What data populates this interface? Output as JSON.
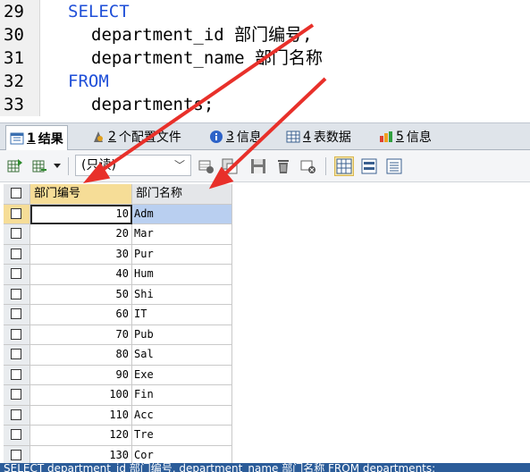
{
  "editor": {
    "lines": [
      {
        "num": "29",
        "text": "SELECT",
        "keyword": true
      },
      {
        "num": "30",
        "text": "department_id 部门编号,",
        "keyword": false
      },
      {
        "num": "31",
        "text": "department_name 部门名称",
        "keyword": false
      },
      {
        "num": "32",
        "text": "FROM",
        "keyword": true
      },
      {
        "num": "33",
        "text": "departments;",
        "keyword": false
      }
    ]
  },
  "tabs": [
    {
      "num": "1",
      "label": "结果",
      "icon": "results-icon",
      "active": true
    },
    {
      "num": "2",
      "label": "个配置文件",
      "icon": "profile-icon",
      "active": false
    },
    {
      "num": "3",
      "label": "信息",
      "icon": "info-icon",
      "active": false
    },
    {
      "num": "4",
      "label": "表数据",
      "icon": "table-data-icon",
      "active": false
    },
    {
      "num": "5",
      "label": "信息",
      "icon": "history-info-icon",
      "active": false
    }
  ],
  "toolbar": {
    "mode_select": "(只读)",
    "buttons": [
      "export-icon",
      "import-icon",
      "add-row-icon",
      "duplicate-row-icon",
      "save-icon",
      "delete-icon",
      "refresh-icon",
      "grid-view-icon",
      "form-view-icon",
      "text-view-icon"
    ]
  },
  "grid": {
    "columns": [
      "部门编号",
      "部门名称"
    ],
    "rows": [
      [
        "10",
        "Adm"
      ],
      [
        "20",
        "Mar"
      ],
      [
        "30",
        "Pur"
      ],
      [
        "40",
        "Hum"
      ],
      [
        "50",
        "Shi"
      ],
      [
        "60",
        "IT"
      ],
      [
        "70",
        "Pub"
      ],
      [
        "80",
        "Sal"
      ],
      [
        "90",
        "Exe"
      ],
      [
        "100",
        "Fin"
      ],
      [
        "110",
        "Acc"
      ],
      [
        "120",
        "Tre"
      ],
      [
        "130",
        "Cor"
      ]
    ],
    "selected_row": 0
  },
  "status": {
    "text": "SELECT department_id 部门编号, department_name 部门名称 FROM departments;"
  },
  "colors": {
    "keyword": "#1f4fd8",
    "arrow": "#e8302a",
    "header_highlight": "#f6dd97",
    "status_bar": "#2b5c99"
  }
}
